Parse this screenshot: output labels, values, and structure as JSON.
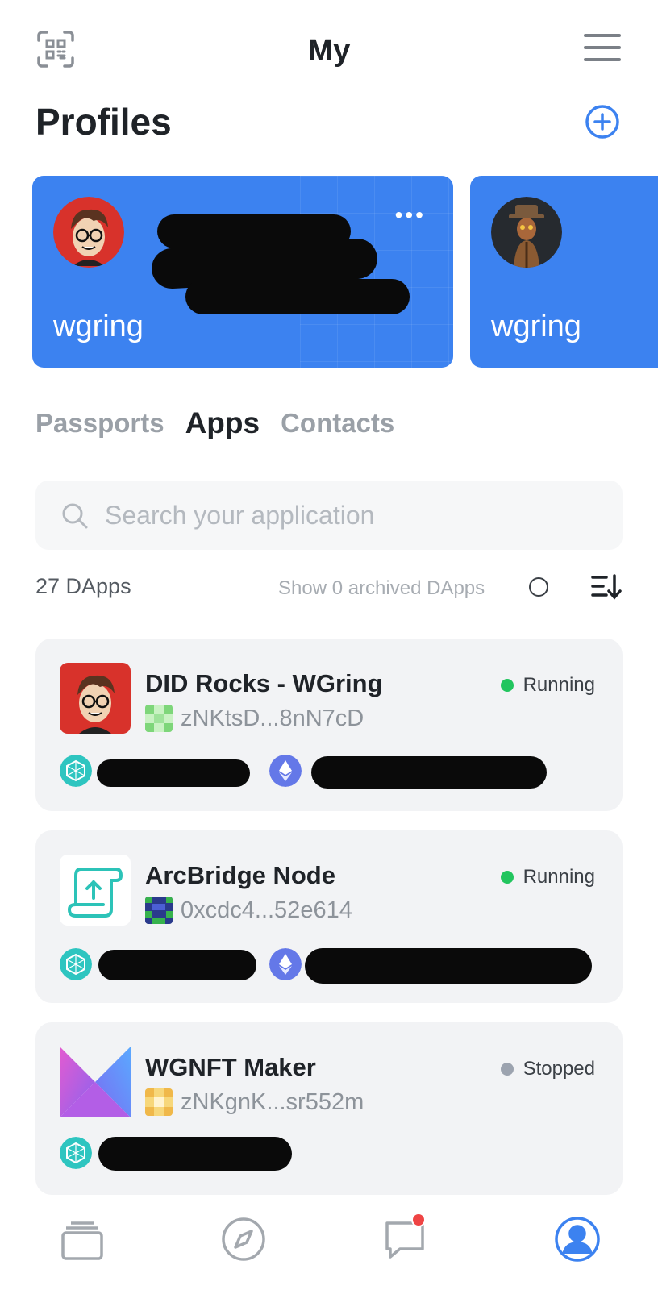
{
  "header": {
    "title": "My",
    "qr_icon": "qr-scan-icon",
    "menu_icon": "menu-icon"
  },
  "profiles": {
    "section_title": "Profiles",
    "add_icon": "add-circle-icon",
    "cards": [
      {
        "name": "wgring",
        "more_label": "•••"
      },
      {
        "name": "wgring"
      }
    ]
  },
  "tabs": [
    {
      "label": "Passports",
      "active": false
    },
    {
      "label": "Apps",
      "active": true
    },
    {
      "label": "Contacts",
      "active": false
    }
  ],
  "search": {
    "placeholder": "Search your application",
    "value": ""
  },
  "list_header": {
    "count": "27 DApps",
    "archived_toggle": "Show 0 archived DApps",
    "sort_icon": "sort-icon"
  },
  "apps": [
    {
      "name": "DID Rocks - WGring",
      "address": "zNKtsD...8nN7cD",
      "status": "Running",
      "status_color": "#22c55e"
    },
    {
      "name": "ArcBridge Node",
      "address": "0xcdc4...52e614",
      "status": "Running",
      "status_color": "#22c55e"
    },
    {
      "name": "WGNFT Maker",
      "address": "zNKgnK...sr552m",
      "status": "Stopped",
      "status_color": "#9ca3af"
    }
  ],
  "colors": {
    "accent": "#3c82f0",
    "card_bg": "#f2f3f5",
    "notification": "#ef4444"
  },
  "bottom_nav": [
    {
      "icon": "wallet-stack-icon"
    },
    {
      "icon": "compass-icon"
    },
    {
      "icon": "chat-icon",
      "has_notification": true
    },
    {
      "icon": "profile-icon",
      "active": true
    }
  ]
}
